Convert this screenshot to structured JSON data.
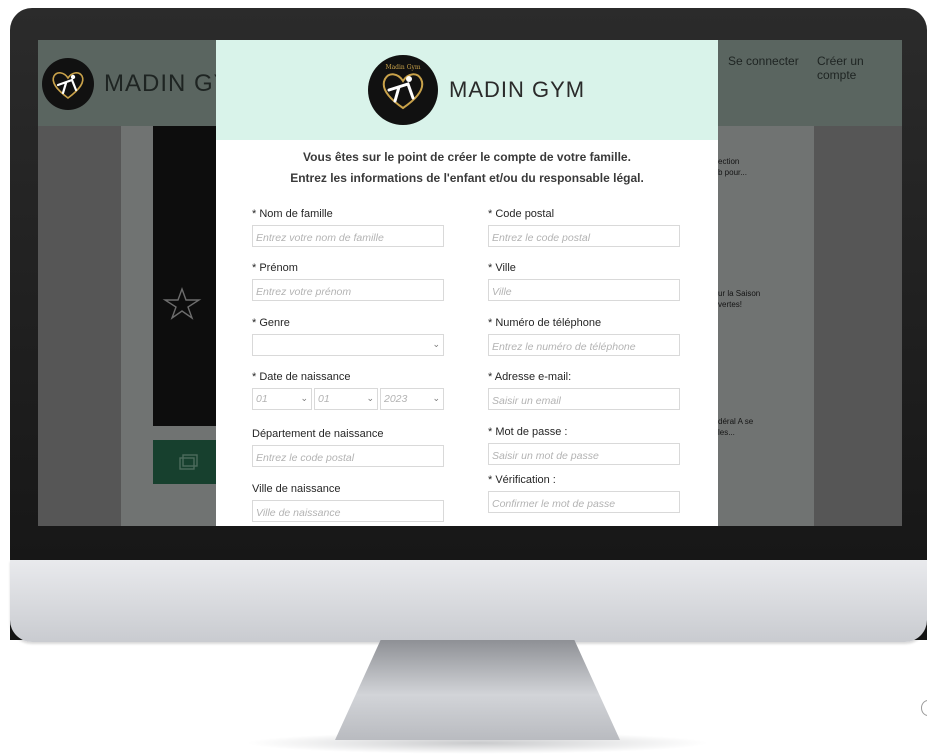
{
  "site": {
    "brand": "MADIN GY",
    "nav": {
      "login": "Se connecter",
      "signup": "Créer un compte"
    },
    "news": [
      {
        "text": "ection\nb pour..."
      },
      {
        "text": "ur la Saison\nvertes!"
      },
      {
        "text": "déral A se\nles..."
      }
    ]
  },
  "modal": {
    "logo_text": "Madin Gym",
    "brand": "MADIN GYM",
    "intro_line1": "Vous êtes sur le point de créer le compte de votre famille.",
    "intro_line2": "Entrez les informations de l'enfant et/ou du responsable légal.",
    "fields": {
      "last_name": {
        "label": "* Nom de famille",
        "placeholder": "Entrez votre nom de famille"
      },
      "first_name": {
        "label": "* Prénom",
        "placeholder": "Entrez votre prénom"
      },
      "gender": {
        "label": "* Genre",
        "value": ""
      },
      "birth_date": {
        "label": "* Date de naissance",
        "day": "01",
        "month": "01",
        "year": "2023"
      },
      "birth_department": {
        "label": "Département de naissance",
        "placeholder": "Entrez le code postal"
      },
      "birth_city": {
        "label": "Ville de naissance",
        "placeholder": "Ville de naissance"
      },
      "postal_code": {
        "label": "* Code postal",
        "placeholder": "Entrez le code postal"
      },
      "city": {
        "label": "* Ville",
        "placeholder": "Ville"
      },
      "phone": {
        "label": "* Numéro de téléphone",
        "placeholder": "Entrez le numéro de téléphone"
      },
      "email": {
        "label": "* Adresse e-mail:",
        "placeholder": "Saisir un email"
      },
      "password": {
        "label": "* Mot de passe :",
        "placeholder": "Saisir un mot de passe"
      },
      "verification": {
        "label": "* Vérification :",
        "placeholder": "Confirmer le mot de passe"
      }
    }
  },
  "icons": {
    "site_logo": "gymnast-heart-logo",
    "modal_logo": "gymnast-heart-logo",
    "hero": "star-icon",
    "dropdown": "chevron-down-icon"
  },
  "colors": {
    "modal_header_bg": "#d9f3ea",
    "overlay_header": "#5a6560",
    "logo_gold": "#c9a24a",
    "monitor_bezel": "#1c1c1c"
  }
}
